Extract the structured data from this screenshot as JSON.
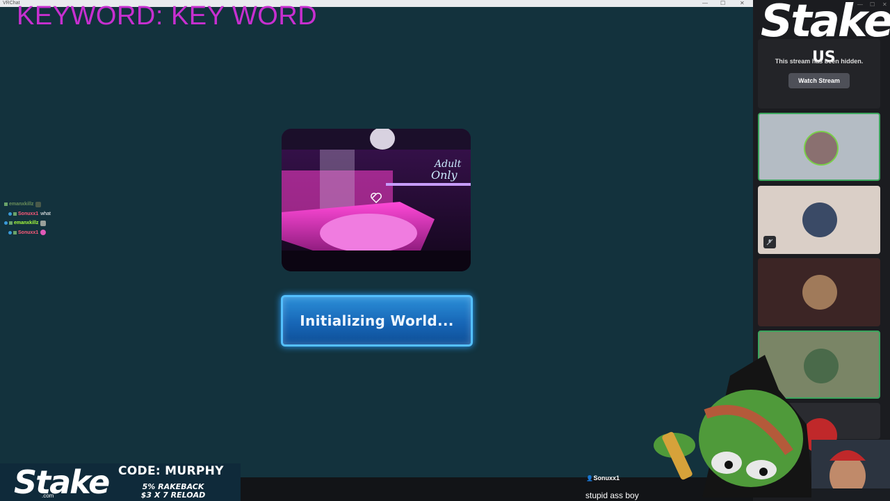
{
  "window": {
    "title": "VRChat",
    "controls": [
      "—",
      "☐",
      "✕"
    ]
  },
  "overlay": {
    "keyword": "KEYWORD: KEY WORD"
  },
  "chat": [
    {
      "user": "emanxkillz",
      "text": "",
      "color": "#6b8f5a",
      "badge": "member"
    },
    {
      "user": "Sonuxx1",
      "text": "what",
      "color": "#ff5a7a",
      "badge": "sub"
    },
    {
      "user": "emanxkillz",
      "text": "",
      "color": "#a8ff3c",
      "badge": "sub"
    },
    {
      "user": "Sonuxx1",
      "text": "",
      "color": "#ff5a7a",
      "badge": "sub"
    }
  ],
  "world": {
    "sign_line1": "Adult",
    "sign_line2": "Only"
  },
  "loading": {
    "label": "Initializing World..."
  },
  "discord": {
    "stream_hidden": "This stream has been hidden.",
    "watch_button": "Watch Stream",
    "brand": {
      "name": "Stake",
      "region": "US"
    }
  },
  "tiles": [
    {
      "bg": "#b4bcc4",
      "speaking": true,
      "muted": false
    },
    {
      "bg": "#dacfc7",
      "speaking": false,
      "muted": true
    },
    {
      "bg": "#3c2525",
      "speaking": false,
      "muted": false
    },
    {
      "bg": "#7a8566",
      "speaking": true,
      "muted": false
    },
    {
      "bg": "#2a2b30",
      "speaking": false,
      "muted": false
    }
  ],
  "promo": {
    "logo": "Stake",
    "domain": ".com",
    "code": "CODE: MURPHY",
    "line1": "5% RAKEBACK",
    "line2": "$3 X 7 RELOAD"
  },
  "message": {
    "user": "Sonuxx1",
    "text": "stupid ass boy"
  },
  "colors": {
    "accent_button": "#1766b6",
    "keyword": "#c72fd0",
    "speaking": "#3ba55d"
  }
}
